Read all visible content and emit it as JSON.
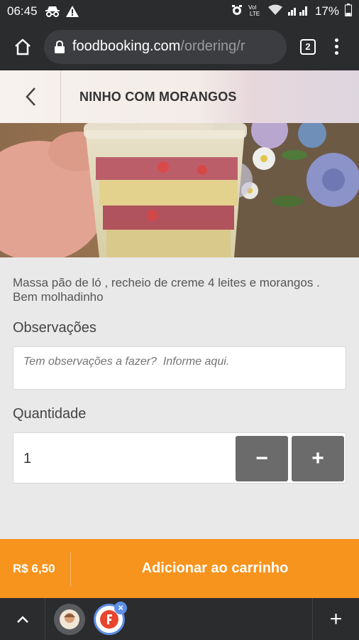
{
  "status_bar": {
    "time": "06:45",
    "battery": "17%",
    "icons": [
      "incognito-icon",
      "warning-icon",
      "alarm-icon",
      "volte-icon",
      "wifi-icon",
      "signal-icon",
      "battery-icon"
    ]
  },
  "browser": {
    "url_domain": "foodbooking.com",
    "url_path": "/ordering/r",
    "tab_count": "2"
  },
  "header": {
    "title": "NINHO COM MORANGOS"
  },
  "product": {
    "description": "Massa pão de ló , recheio de creme 4 leites e morangos . Bem molhadinho"
  },
  "observations": {
    "label": "Observações",
    "placeholder": "Tem observações a fazer?  Informe aqui."
  },
  "quantity": {
    "label": "Quantidade",
    "value": "1",
    "minus": "−",
    "plus": "+"
  },
  "order": {
    "price": "R$ 6,50",
    "add_label": "Adicionar ao carrinho"
  },
  "bottom_bar": {
    "new_tab": "+",
    "close": "×"
  },
  "colors": {
    "accent": "#f7941d",
    "chrome_dark": "#2b2c2e",
    "qty_button": "#6b6b6b"
  }
}
